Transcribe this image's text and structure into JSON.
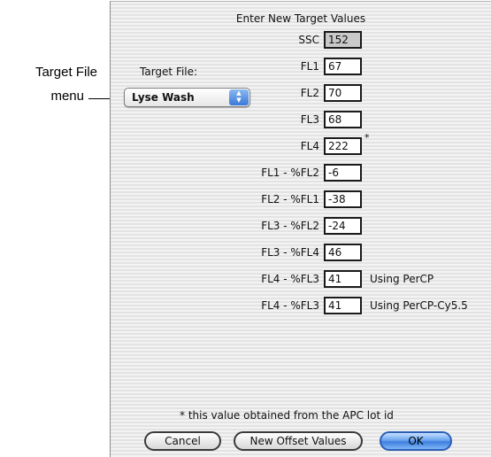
{
  "callout": {
    "line1": "Target File",
    "line2": "menu"
  },
  "dialog": {
    "title": "Enter New Target Values",
    "target_file_label": "Target File:",
    "target_file_value": "Lyse Wash",
    "rows": [
      {
        "label": "SSC",
        "value": "152",
        "readonly": true
      },
      {
        "label": "FL1",
        "value": "67"
      },
      {
        "label": "FL2",
        "value": "70"
      },
      {
        "label": "FL3",
        "value": "68"
      },
      {
        "label": "FL4",
        "value": "222",
        "marker": "*"
      },
      {
        "label": "FL1 - %FL2",
        "value": "-6"
      },
      {
        "label": "FL2 - %FL1",
        "value": "-38"
      },
      {
        "label": "FL3 - %FL2",
        "value": "-24"
      },
      {
        "label": "FL3 - %FL4",
        "value": "46"
      },
      {
        "label": "FL4 - %FL3",
        "value": "41",
        "note": "Using PerCP"
      },
      {
        "label": "FL4 - %FL3",
        "value": "41",
        "note": "Using PerCP-Cy5.5"
      }
    ],
    "footnote": "* this value obtained from the APC lot id",
    "buttons": {
      "cancel": "Cancel",
      "new_offset": "New Offset Values",
      "ok": "OK"
    },
    "popup_arrow_glyph": "▲▼"
  }
}
